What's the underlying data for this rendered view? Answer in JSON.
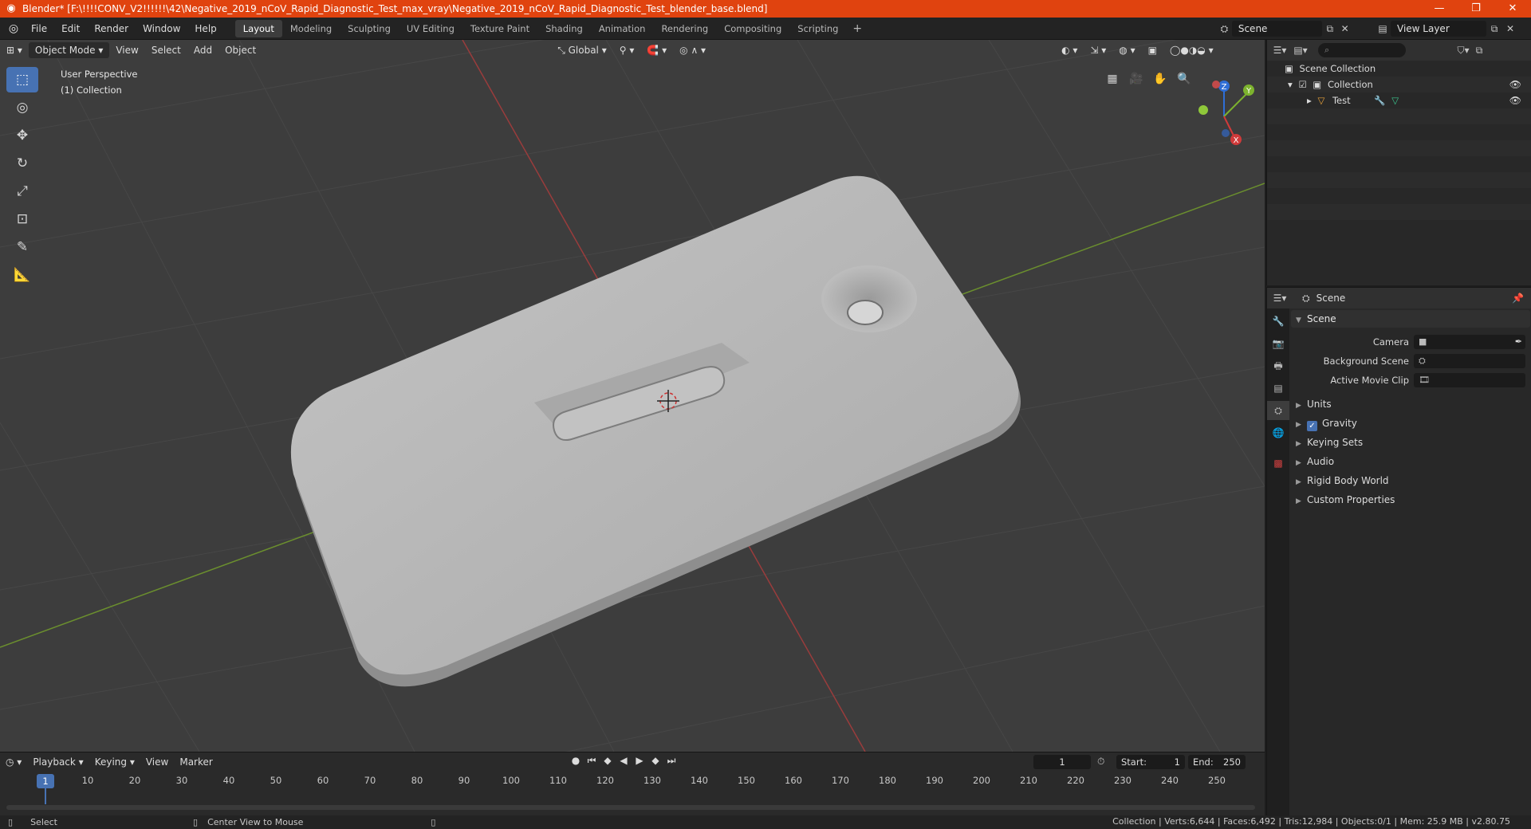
{
  "window": {
    "title": "Blender* [F:\\!!!!CONV_V2!!!!!!\\42\\Negative_2019_nCoV_Rapid_Diagnostic_Test_max_vray\\Negative_2019_nCoV_Rapid_Diagnostic_Test_blender_base.blend]",
    "controls": {
      "minimize": "—",
      "maximize": "❐",
      "close": "✕"
    }
  },
  "menubar": {
    "items": [
      "File",
      "Edit",
      "Render",
      "Window",
      "Help"
    ],
    "workspaces": [
      "Layout",
      "Modeling",
      "Sculpting",
      "UV Editing",
      "Texture Paint",
      "Shading",
      "Animation",
      "Rendering",
      "Compositing",
      "Scripting"
    ],
    "active_workspace": "Layout",
    "add_workspace": "+",
    "scene": "Scene",
    "view_layer": "View Layer"
  },
  "viewport": {
    "mode": "Object Mode",
    "menus": [
      "View",
      "Select",
      "Add",
      "Object"
    ],
    "transform_orientation": "Global",
    "perspective_label": "User Perspective",
    "collection_label": "(1) Collection",
    "gizmo_axes": {
      "x": "X",
      "y": "Y",
      "z": "Z"
    },
    "colors": {
      "background": "#3d3d3d",
      "x_axis": "#d03a3a",
      "y_axis": "#7db32e",
      "active_tool": "#4772b3",
      "object_grey": "#b4b4b4"
    }
  },
  "timeline": {
    "menus": [
      "Playback",
      "Keying",
      "View",
      "Marker"
    ],
    "current_frame": "1",
    "start_label": "Start:",
    "start": "1",
    "end_label": "End:",
    "end": "250",
    "ruler": [
      "10",
      "20",
      "30",
      "40",
      "50",
      "60",
      "70",
      "80",
      "90",
      "100",
      "110",
      "120",
      "130",
      "140",
      "150",
      "160",
      "170",
      "180",
      "190",
      "200",
      "210",
      "220",
      "230",
      "240",
      "250"
    ],
    "playhead": "1"
  },
  "statusbar": {
    "select": "Select",
    "center_view": "Center View to Mouse",
    "stats": "Collection | Verts:6,644 | Faces:6,492 | Tris:12,984 | Objects:0/1 | Mem: 25.9 MB | v2.80.75"
  },
  "outliner": {
    "search_placeholder": "",
    "scene_collection": "Scene Collection",
    "collection": "Collection",
    "object": "Test"
  },
  "properties": {
    "context": "Scene",
    "panel": "Scene",
    "camera_label": "Camera",
    "background_scene_label": "Background Scene",
    "active_movie_clip_label": "Active Movie Clip",
    "subpanels": [
      "Units",
      "Gravity",
      "Keying Sets",
      "Audio",
      "Rigid Body World",
      "Custom Properties"
    ],
    "gravity_checked": true
  }
}
